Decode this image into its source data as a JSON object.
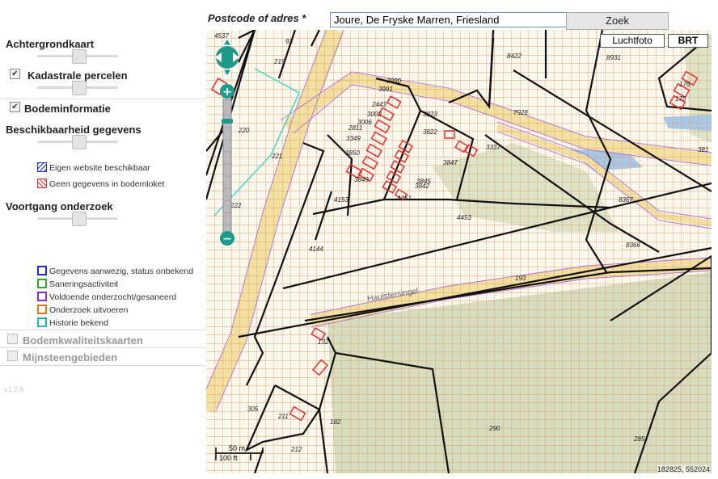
{
  "panel": {
    "achtergrondkaart": "Achtergrondkaart",
    "kadastrale_percelen": "Kadastrale percelen",
    "bodeminformatie": "Bodeminformatie",
    "beschikbaarheid": "Beschikbaarheid gegevens",
    "legend_beschikbaar": [
      {
        "label": "Eigen website beschikbaar",
        "color": "#1c2bd6"
      },
      {
        "label": "Geen gegevens in bodemloket",
        "color": "#e53030"
      }
    ],
    "voortgang": "Voortgang onderzoek",
    "legend_voortgang": [
      {
        "label": "Gegevens aanwezig, status onbekend",
        "color": "#1c2bd6"
      },
      {
        "label": "Saneringsactiviteit",
        "color": "#2bb02b"
      },
      {
        "label": "Voldoende onderzocht/gesaneerd",
        "color": "#8a2bd6"
      },
      {
        "label": "Onderzoek uitvoeren",
        "color": "#e07a10"
      },
      {
        "label": "Historie bekend",
        "color": "#20b5b5"
      }
    ],
    "bodemkwaliteitskaarten": "Bodemkwaliteitskaarten",
    "mijnsteengebieden": "Mijnsteengebieden",
    "version": "v1.2.6"
  },
  "search": {
    "label": "Postcode of adres *",
    "value": "Joure, De Fryske Marren, Friesland",
    "button": "Zoek"
  },
  "map": {
    "luchtfoto": "Luchtfoto",
    "brt": "BRT",
    "scale_50": "50 m",
    "scale_100": "100 ft",
    "coords": "182825, 552024",
    "street": "Haulstersingel",
    "grid_color": "#e3a060",
    "parcel_numbers": [
      "4537",
      "93",
      "219",
      "220",
      "221",
      "222",
      "8422",
      "8931",
      "7928",
      "3823",
      "3822",
      "3337",
      "3990",
      "3991",
      "2443",
      "3002",
      "3006",
      "2811",
      "3349",
      "3850",
      "3849",
      "4153",
      "3845",
      "4451",
      "4453",
      "4144",
      "8367",
      "8366",
      "193",
      "132",
      "305",
      "211",
      "182",
      "212",
      "290",
      "285",
      "176",
      "175",
      "3847",
      "3842",
      "381"
    ]
  }
}
